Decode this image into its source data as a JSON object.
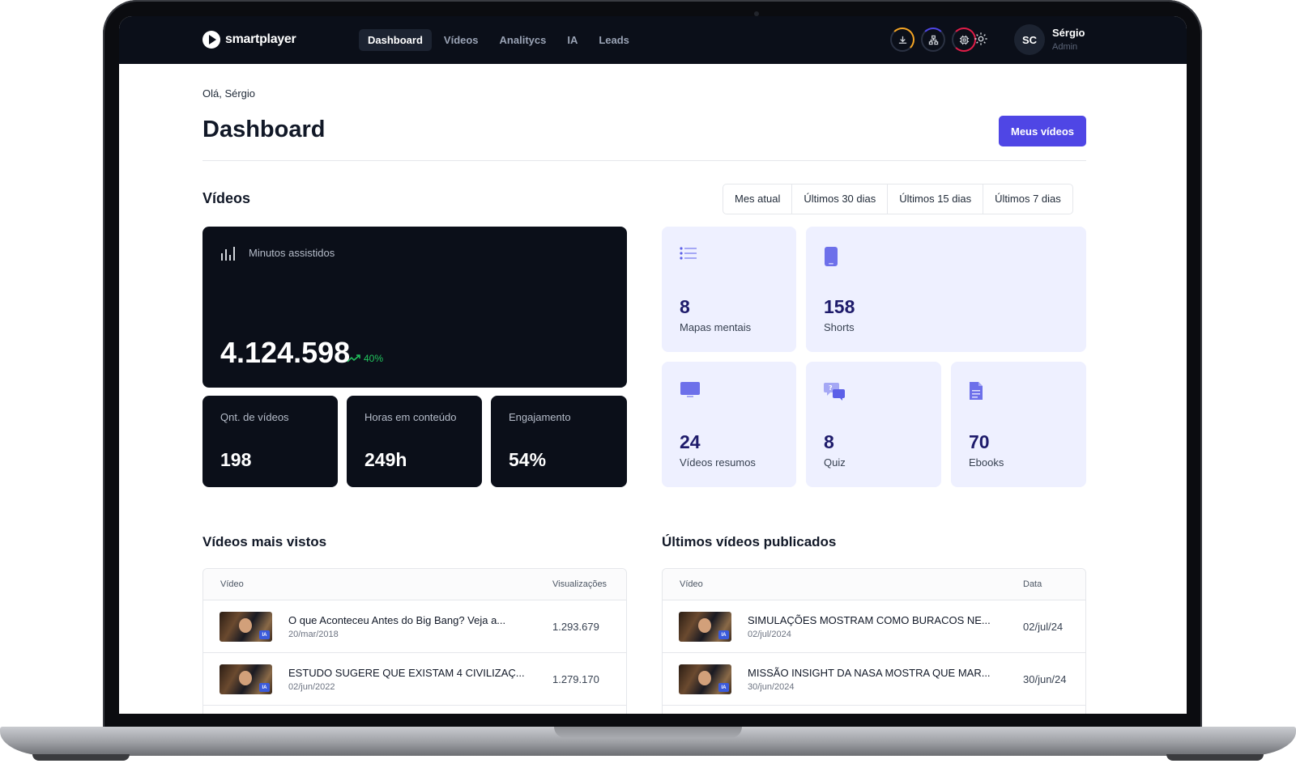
{
  "brand": {
    "name": "smartplayer"
  },
  "nav": {
    "items": [
      "Dashboard",
      "Vídeos",
      "Analitycs",
      "IA",
      "Leads"
    ]
  },
  "user": {
    "initials": "SC",
    "name": "Sérgio",
    "role": "Admin"
  },
  "header_icons": [
    "download-icon",
    "sitemap-icon",
    "chip-icon",
    "gear-icon"
  ],
  "greeting": "Olá, Sérgio",
  "page_title": "Dashboard",
  "primary_button": "Meus vídeos",
  "videos_section": {
    "title": "Vídeos",
    "filters": [
      "Mes atual",
      "Últimos 30 dias",
      "Últimos 15 dias",
      "Últimos 7 dias"
    ]
  },
  "watched": {
    "label": "Minutos assistidos",
    "value": "4.124.598",
    "trend": "40%"
  },
  "stats": [
    {
      "label": "Qnt. de vídeos",
      "value": "198"
    },
    {
      "label": "Horas em conteúdo",
      "value": "249h"
    },
    {
      "label": "Engajamento",
      "value": "54%"
    }
  ],
  "assets": [
    {
      "value": "8",
      "label": "Mapas mentais",
      "icon": "list-icon"
    },
    {
      "value": "158",
      "label": "Shorts",
      "icon": "phone-icon"
    },
    {
      "value": "24",
      "label": "Vídeos resumos",
      "icon": "monitor-icon"
    },
    {
      "value": "8",
      "label": "Quiz",
      "icon": "chat-question-icon"
    },
    {
      "value": "70",
      "label": "Ebooks",
      "icon": "document-icon"
    }
  ],
  "most_viewed": {
    "title": "Vídeos mais vistos",
    "columns": [
      "Vídeo",
      "Visualizações"
    ],
    "rows": [
      {
        "title": "O que Aconteceu Antes do Big Bang? Veja a...",
        "date": "20/mar/2018",
        "value": "1.293.679",
        "badge": "IA"
      },
      {
        "title": "ESTUDO SUGERE QUE EXISTAM 4 CIVILIZAÇ...",
        "date": "02/jun/2022",
        "value": "1.279.170",
        "badge": "IA"
      }
    ]
  },
  "latest": {
    "title": "Últimos vídeos publicados",
    "columns": [
      "Vídeo",
      "Data"
    ],
    "rows": [
      {
        "title": "SIMULAÇÕES MOSTRAM COMO BURACOS NE...",
        "date": "02/jul/2024",
        "value": "02/jul/24",
        "badge": "IA"
      },
      {
        "title": "MISSÃO INSIGHT DA NASA MOSTRA QUE MAR...",
        "date": "30/jun/2024",
        "value": "30/jun/24",
        "badge": "IA"
      }
    ]
  },
  "colors": {
    "accent": "#4f46e5",
    "dark": "#0b0f19",
    "card_light": "#eef0ff",
    "trend": "#22c55e"
  }
}
